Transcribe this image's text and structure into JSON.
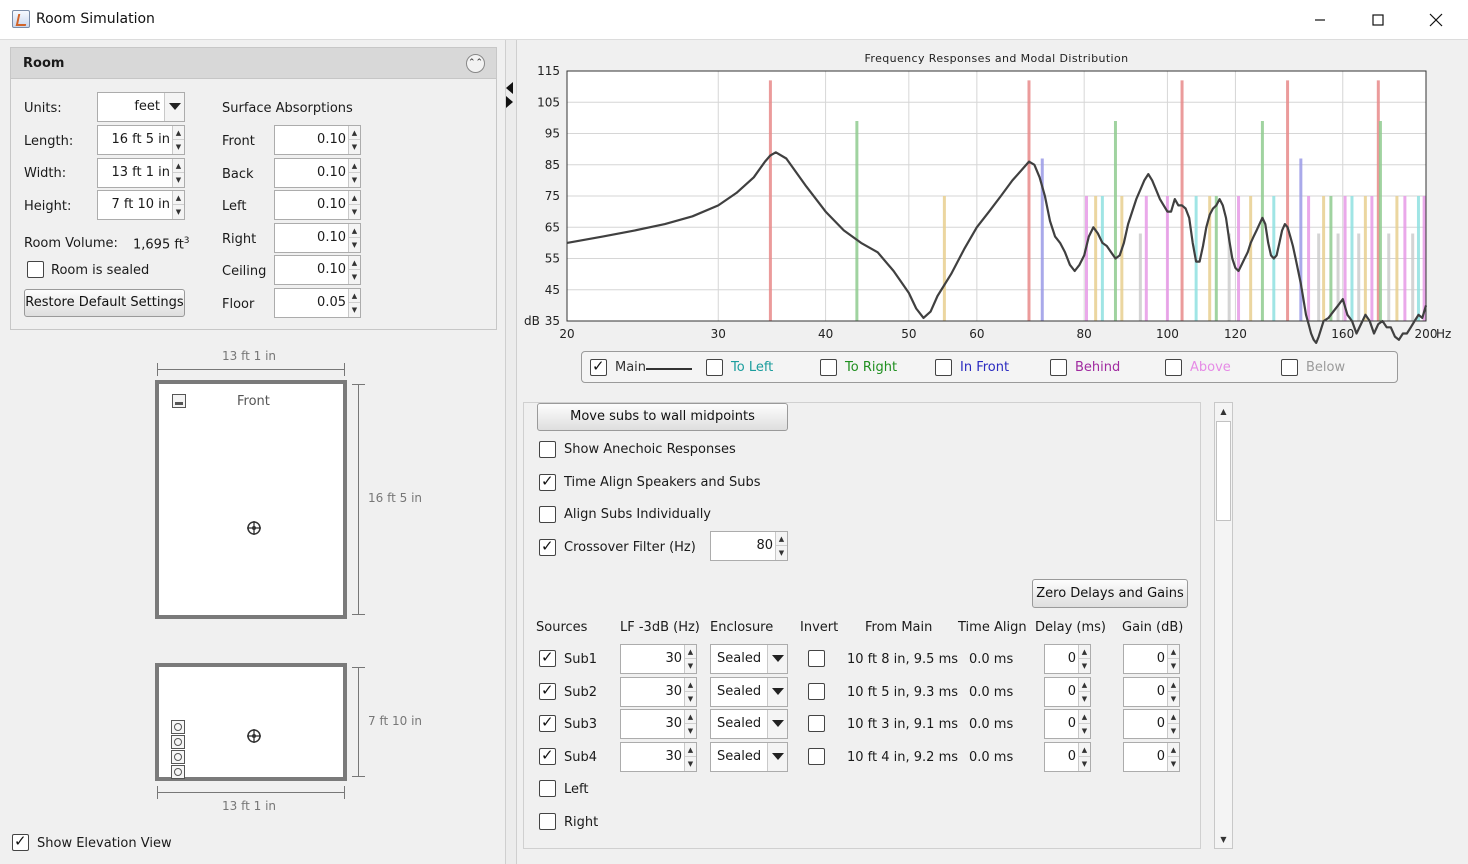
{
  "window": {
    "title": "Room Simulation",
    "minimize_icon": "minimize-icon",
    "maximize_icon": "maximize-icon",
    "close_icon": "close-icon"
  },
  "room_panel": {
    "title": "Room",
    "units_label": "Units:",
    "units_value": "feet",
    "length_label": "Length:",
    "length_value": "16 ft 5 in",
    "width_label": "Width:",
    "width_value": "13 ft 1 in",
    "height_label": "Height:",
    "height_value": "7 ft 10 in",
    "volume_label": "Room Volume:",
    "volume_value": "1,695 ft",
    "volume_sup": "3",
    "sealed_label": "Room is sealed",
    "sealed_checked": false,
    "restore_button": "Restore Default Settings",
    "absorptions_title": "Surface Absorptions",
    "absorptions": [
      {
        "label": "Front",
        "value": "0.10"
      },
      {
        "label": "Back",
        "value": "0.10"
      },
      {
        "label": "Left",
        "value": "0.10"
      },
      {
        "label": "Right",
        "value": "0.10"
      },
      {
        "label": "Ceiling",
        "value": "0.10"
      },
      {
        "label": "Floor",
        "value": "0.05"
      }
    ]
  },
  "plan_view": {
    "top_dim": "13 ft 1 in",
    "side_dim": "16 ft 5 in",
    "front_label": "Front"
  },
  "elevation_view": {
    "side_dim": "7 ft 10 in",
    "bottom_dim": "13 ft 1 in"
  },
  "show_elevation": {
    "label": "Show Elevation View",
    "checked": true
  },
  "chart_data": {
    "type": "line",
    "title": "Frequency Responses and Modal Distribution",
    "xscale": "log",
    "xlim": [
      20,
      200
    ],
    "ylim": [
      35,
      115
    ],
    "ylabel_unit": "dB",
    "xlabel_unit": "Hz",
    "x_ticks": [
      20,
      30,
      40,
      50,
      60,
      80,
      100,
      120,
      160,
      200
    ],
    "y_ticks": [
      35,
      45,
      55,
      65,
      75,
      85,
      95,
      105,
      115
    ],
    "grid": true,
    "series": [
      {
        "name": "Main",
        "color": "#404040",
        "x": [
          20,
          22,
          24,
          26,
          28,
          30,
          31.5,
          33,
          34,
          34.5,
          35,
          36,
          38,
          40,
          42,
          44,
          46,
          48,
          50,
          51,
          52,
          53,
          54,
          56,
          58,
          60,
          62,
          64,
          66,
          68,
          69,
          70,
          71,
          72,
          73,
          74,
          75,
          76,
          77,
          78,
          79,
          80,
          81,
          82,
          83,
          84,
          85,
          86,
          87,
          88,
          89,
          90,
          91,
          92,
          93,
          94,
          95,
          96,
          97,
          98,
          99,
          100,
          101,
          102,
          103,
          104,
          105,
          106,
          107,
          108,
          109,
          110,
          111,
          112,
          113,
          114,
          115,
          116,
          117,
          118,
          119,
          120,
          121,
          122,
          123,
          124,
          125,
          126,
          127,
          128,
          129,
          130,
          131,
          132,
          133,
          134,
          135,
          136,
          137,
          138,
          139,
          140,
          141,
          142,
          143,
          144,
          145,
          146,
          147,
          148,
          149,
          150,
          152,
          154,
          156,
          158,
          160,
          162,
          164,
          166,
          168,
          170,
          172,
          174,
          176,
          178,
          180,
          182,
          184,
          186,
          188,
          190,
          192,
          194,
          196,
          198,
          200
        ],
        "y": [
          60,
          62,
          64,
          66,
          68.5,
          72,
          76,
          81,
          86,
          88,
          89,
          87,
          78,
          70,
          64,
          60,
          57,
          51,
          44,
          39,
          36,
          38,
          43,
          50,
          58,
          65,
          70,
          75,
          80,
          84,
          86,
          85,
          81,
          75,
          67,
          62,
          60,
          57,
          53,
          51,
          53,
          56,
          62,
          65,
          63,
          60,
          59,
          57,
          55,
          56,
          60,
          66,
          70,
          74,
          77,
          80,
          82,
          80,
          77,
          74,
          72,
          70,
          70,
          74,
          72,
          72,
          71,
          68,
          60,
          54,
          54,
          59,
          65,
          69,
          71,
          72,
          74,
          72,
          68,
          61,
          55,
          52,
          51,
          53,
          55,
          57,
          60,
          62,
          64,
          66,
          68,
          66,
          60,
          56,
          55,
          56,
          60,
          64,
          66,
          65,
          62,
          59,
          55,
          51,
          47,
          42,
          37,
          34,
          31,
          29,
          28,
          30,
          35,
          36,
          38,
          40,
          42,
          37,
          35,
          31,
          34,
          37,
          35,
          31,
          34,
          35,
          33,
          33,
          30,
          29,
          31,
          31,
          33,
          35,
          37,
          36,
          40
        ]
      }
    ],
    "modes": [
      {
        "x": 34.5,
        "top": 112,
        "color": "#e88a8a"
      },
      {
        "x": 43.5,
        "top": 99,
        "color": "#8fcb8f"
      },
      {
        "x": 55,
        "top": 75,
        "color": "#e7cf8f"
      },
      {
        "x": 69,
        "top": 112,
        "color": "#e88a8a"
      },
      {
        "x": 71.5,
        "top": 87,
        "color": "#9a9ae6"
      },
      {
        "x": 80.5,
        "top": 75,
        "color": "#e69ae6"
      },
      {
        "x": 82.5,
        "top": 75,
        "color": "#e7cf8f"
      },
      {
        "x": 84,
        "top": 75,
        "color": "#8fe0e0"
      },
      {
        "x": 87,
        "top": 99,
        "color": "#8fcb8f"
      },
      {
        "x": 88.5,
        "top": 75,
        "color": "#e7cf8f"
      },
      {
        "x": 93,
        "top": 63,
        "color": "#cccccc"
      },
      {
        "x": 94.5,
        "top": 75,
        "color": "#e69ae6"
      },
      {
        "x": 100,
        "top": 75,
        "color": "#e69ae6"
      },
      {
        "x": 104,
        "top": 112,
        "color": "#e88a8a"
      },
      {
        "x": 108,
        "top": 75,
        "color": "#8fe0e0"
      },
      {
        "x": 112,
        "top": 75,
        "color": "#e7cf8f"
      },
      {
        "x": 114,
        "top": 75,
        "color": "#8fcb8f"
      },
      {
        "x": 118,
        "top": 63,
        "color": "#cccccc"
      },
      {
        "x": 121,
        "top": 75,
        "color": "#e69ae6"
      },
      {
        "x": 125,
        "top": 75,
        "color": "#e7cf8f"
      },
      {
        "x": 129,
        "top": 99,
        "color": "#8fcb8f"
      },
      {
        "x": 133,
        "top": 75,
        "color": "#8fe0e0"
      },
      {
        "x": 138,
        "top": 112,
        "color": "#e88a8a"
      },
      {
        "x": 143,
        "top": 87,
        "color": "#9a9ae6"
      },
      {
        "x": 146,
        "top": 75,
        "color": "#e69ae6"
      },
      {
        "x": 150,
        "top": 63,
        "color": "#cccccc"
      },
      {
        "x": 152,
        "top": 75,
        "color": "#e7cf8f"
      },
      {
        "x": 155,
        "top": 75,
        "color": "#8fcb8f"
      },
      {
        "x": 158,
        "top": 63,
        "color": "#cccccc"
      },
      {
        "x": 161,
        "top": 75,
        "color": "#e69ae6"
      },
      {
        "x": 164,
        "top": 75,
        "color": "#8fe0e0"
      },
      {
        "x": 167,
        "top": 63,
        "color": "#cccccc"
      },
      {
        "x": 170,
        "top": 75,
        "color": "#e7cf8f"
      },
      {
        "x": 173,
        "top": 75,
        "color": "#e69ae6"
      },
      {
        "x": 176,
        "top": 112,
        "color": "#e88a8a"
      },
      {
        "x": 177,
        "top": 99,
        "color": "#8fcb8f"
      },
      {
        "x": 181,
        "top": 63,
        "color": "#cccccc"
      },
      {
        "x": 185,
        "top": 75,
        "color": "#e7cf8f"
      },
      {
        "x": 189,
        "top": 75,
        "color": "#e69ae6"
      },
      {
        "x": 193,
        "top": 63,
        "color": "#cccccc"
      },
      {
        "x": 196,
        "top": 75,
        "color": "#8fe0e0"
      },
      {
        "x": 199,
        "top": 75,
        "color": "#e69ae6"
      }
    ]
  },
  "legend": [
    {
      "label": "Main",
      "color": "#333333",
      "checked": true
    },
    {
      "label": "To Left",
      "color": "#1a9d9d",
      "checked": false
    },
    {
      "label": "To Right",
      "color": "#1f8f1f",
      "checked": false
    },
    {
      "label": "In Front",
      "color": "#2a2ac0",
      "checked": false
    },
    {
      "label": "Behind",
      "color": "#a02aa0",
      "checked": false
    },
    {
      "label": "Above",
      "color": "#e68be6",
      "checked": false
    },
    {
      "label": "Below",
      "color": "#9a9a9a",
      "checked": false
    }
  ],
  "controls": {
    "move_subs_button": "Move subs to wall midpoints",
    "options": [
      {
        "label": "Show Anechoic Responses",
        "checked": false
      },
      {
        "label": "Time Align Speakers and Subs",
        "checked": true
      },
      {
        "label": "Align Subs Individually",
        "checked": false
      },
      {
        "label": "Crossover Filter (Hz)",
        "checked": true
      }
    ],
    "crossover_value": "80",
    "zero_button": "Zero Delays and Gains",
    "headers": {
      "sources": "Sources",
      "lf": "LF -3dB (Hz)",
      "enclosure": "Enclosure",
      "invert": "Invert",
      "from_main": "From Main",
      "time_align": "Time Align",
      "delay": "Delay (ms)",
      "gain": "Gain (dB)"
    },
    "sources": [
      {
        "name": "Sub1",
        "checked": true,
        "lf": "30",
        "enclosure": "Sealed",
        "invert": false,
        "from_main": "10 ft 8 in, 9.5 ms",
        "time_align": "0.0 ms",
        "delay": "0",
        "gain": "0"
      },
      {
        "name": "Sub2",
        "checked": true,
        "lf": "30",
        "enclosure": "Sealed",
        "invert": false,
        "from_main": "10 ft 5 in, 9.3 ms",
        "time_align": "0.0 ms",
        "delay": "0",
        "gain": "0"
      },
      {
        "name": "Sub3",
        "checked": true,
        "lf": "30",
        "enclosure": "Sealed",
        "invert": false,
        "from_main": "10 ft 3 in, 9.1 ms",
        "time_align": "0.0 ms",
        "delay": "0",
        "gain": "0"
      },
      {
        "name": "Sub4",
        "checked": true,
        "lf": "30",
        "enclosure": "Sealed",
        "invert": false,
        "from_main": "10 ft 4 in, 9.2 ms",
        "time_align": "0.0 ms",
        "delay": "0",
        "gain": "0"
      }
    ],
    "extra_sources": [
      {
        "name": "Left",
        "checked": false
      },
      {
        "name": "Right",
        "checked": false
      }
    ]
  }
}
